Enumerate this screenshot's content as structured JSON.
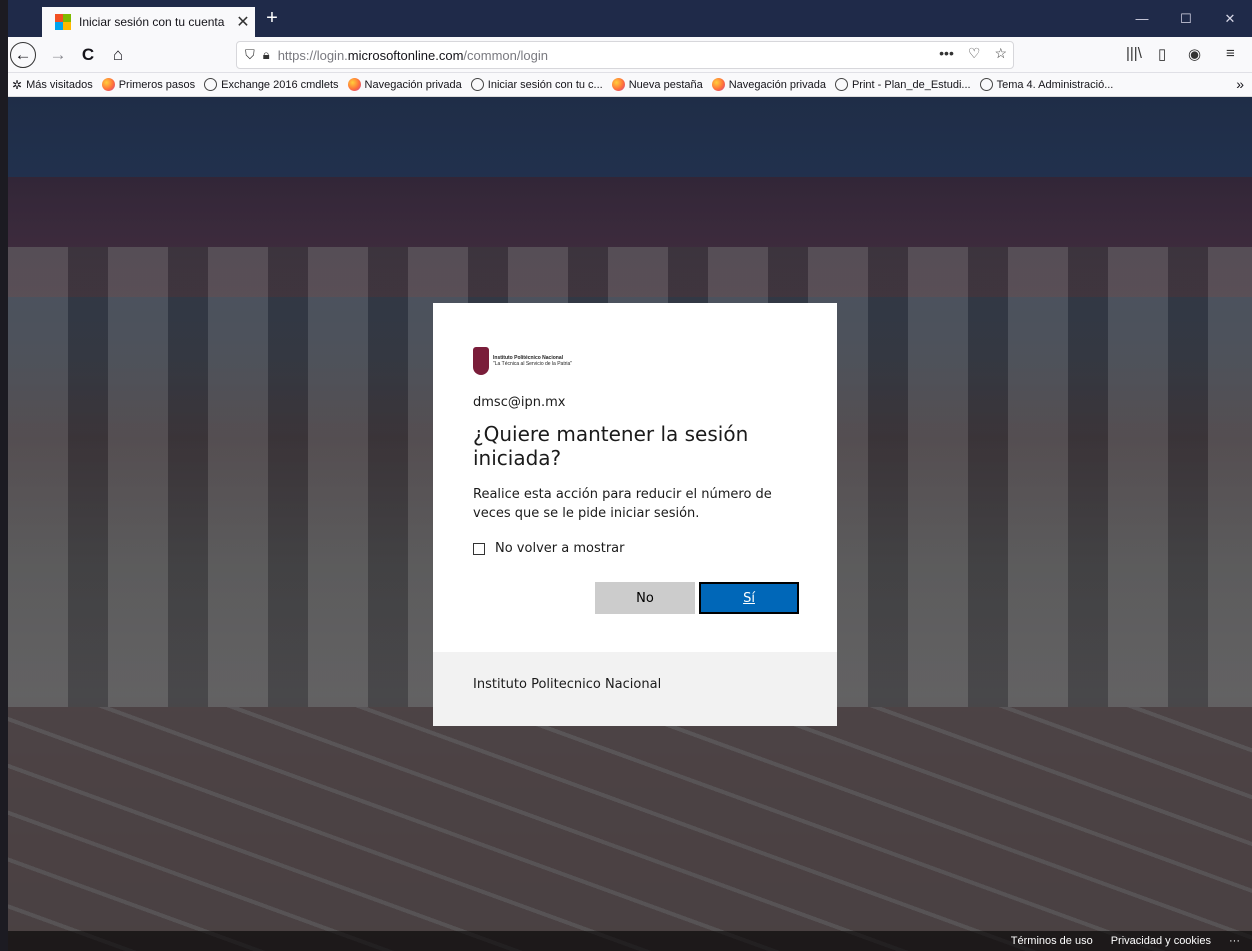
{
  "browser": {
    "tab": {
      "title": "Iniciar sesión con tu cuenta",
      "close_glyph": "✕"
    },
    "new_tab_glyph": "+",
    "window_controls": {
      "minimize": "—",
      "maximize": "☐",
      "close": "✕"
    },
    "nav": {
      "back": "←",
      "forward": "→",
      "reload": "C",
      "home": "⌂"
    },
    "url": {
      "prefix": "https://login.",
      "domain": "microsoftonline.com",
      "path": "/common/login"
    },
    "url_icons": {
      "more": "•••",
      "pocket": "♡",
      "bookmark": "☆"
    },
    "toolbar_icons": {
      "library": "|||\\",
      "sidebar": "▯",
      "account": "◉",
      "menu": "≡"
    },
    "bookmarks": [
      {
        "label": "Más visitados",
        "icon": "gear-icon"
      },
      {
        "label": "Primeros pasos",
        "icon": "firefox-icon"
      },
      {
        "label": "Exchange 2016 cmdlets",
        "icon": "globe-icon"
      },
      {
        "label": "Navegación privada",
        "icon": "firefox-icon"
      },
      {
        "label": "Iniciar sesión con tu c...",
        "icon": "globe-icon"
      },
      {
        "label": "Nueva pestaña",
        "icon": "firefox-icon"
      },
      {
        "label": "Navegación privada",
        "icon": "firefox-icon"
      },
      {
        "label": "Print - Plan_de_Estudi...",
        "icon": "globe-icon"
      },
      {
        "label": "Tema 4. Administració...",
        "icon": "globe-icon"
      }
    ],
    "bookmarks_overflow": "»"
  },
  "dialog": {
    "logo": {
      "name": "Instituto Politécnico Nacional",
      "motto": "\"La Técnica al Servicio de la Patria\""
    },
    "user_email": "dmsc@ipn.mx",
    "title": "¿Quiere mantener la sesión iniciada?",
    "description": "Realice esta acción para reducir el número de veces que se le pide iniciar sesión.",
    "checkbox_label": "No volver a mostrar",
    "no_button": "No",
    "yes_button": "Sí",
    "footer_text": "Instituto Politecnico Nacional"
  },
  "page_footer": {
    "terms": "Términos de uso",
    "privacy": "Privacidad y cookies",
    "more": "···"
  }
}
